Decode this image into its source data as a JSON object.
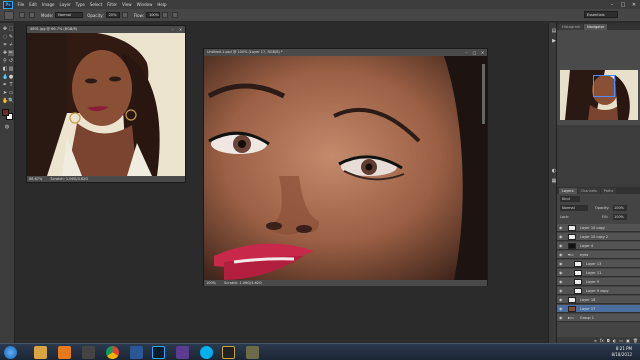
{
  "menubar": {
    "logo": "Ps",
    "items": [
      "File",
      "Edit",
      "Image",
      "Layer",
      "Type",
      "Select",
      "Filter",
      "View",
      "Window",
      "Help"
    ]
  },
  "window_controls": {
    "minimize": "–",
    "maximize": "□",
    "close": "✕"
  },
  "options": {
    "mode_label": "Mode:",
    "mode_value": "Normal",
    "opacity_label": "Opacity:",
    "opacity_value": "20%",
    "flow_label": "Flow:",
    "flow_value": "100%",
    "workspace": "Essentials"
  },
  "doc_small": {
    "title": "4891.jpg @ 66.7% (RGB/8)",
    "zoom": "66.67%",
    "status": "Scratch: 1.06G/4.62G"
  },
  "doc_main": {
    "title": "Untitled-1.psd @ 100% (Layer 17, RGB/8) *",
    "zoom": "100%",
    "status": "Scratch: 1.06G/4.62G"
  },
  "navigator": {
    "tabs": [
      "Histogram",
      "Navigator"
    ]
  },
  "layers_panel": {
    "tabs": [
      "Layers",
      "Channels",
      "Paths"
    ],
    "kind_label": "Kind",
    "blend_mode": "Normal",
    "opacity_label": "Opacity:",
    "opacity_value": "100%",
    "lock_label": "Lock:",
    "fill_label": "Fill:",
    "fill_value": "100%",
    "layers": [
      {
        "name": "Layer 10 copy"
      },
      {
        "name": "Layer 10 copy 2"
      },
      {
        "name": "Layer 4"
      },
      {
        "name": "eyes"
      },
      {
        "name": "Layer 13"
      },
      {
        "name": "Layer 11"
      },
      {
        "name": "Layer 9"
      },
      {
        "name": "Layer 9 copy"
      },
      {
        "name": "Layer 18"
      },
      {
        "name": "Layer 17"
      },
      {
        "name": "Group 1"
      }
    ]
  },
  "taskbar": {
    "time": "8:21 PM",
    "date": "8/18/2012"
  },
  "colors": {
    "accent": "#4b6e9e",
    "foreground_swatch": "#6e2a2a",
    "background_swatch": "#ffffff"
  }
}
